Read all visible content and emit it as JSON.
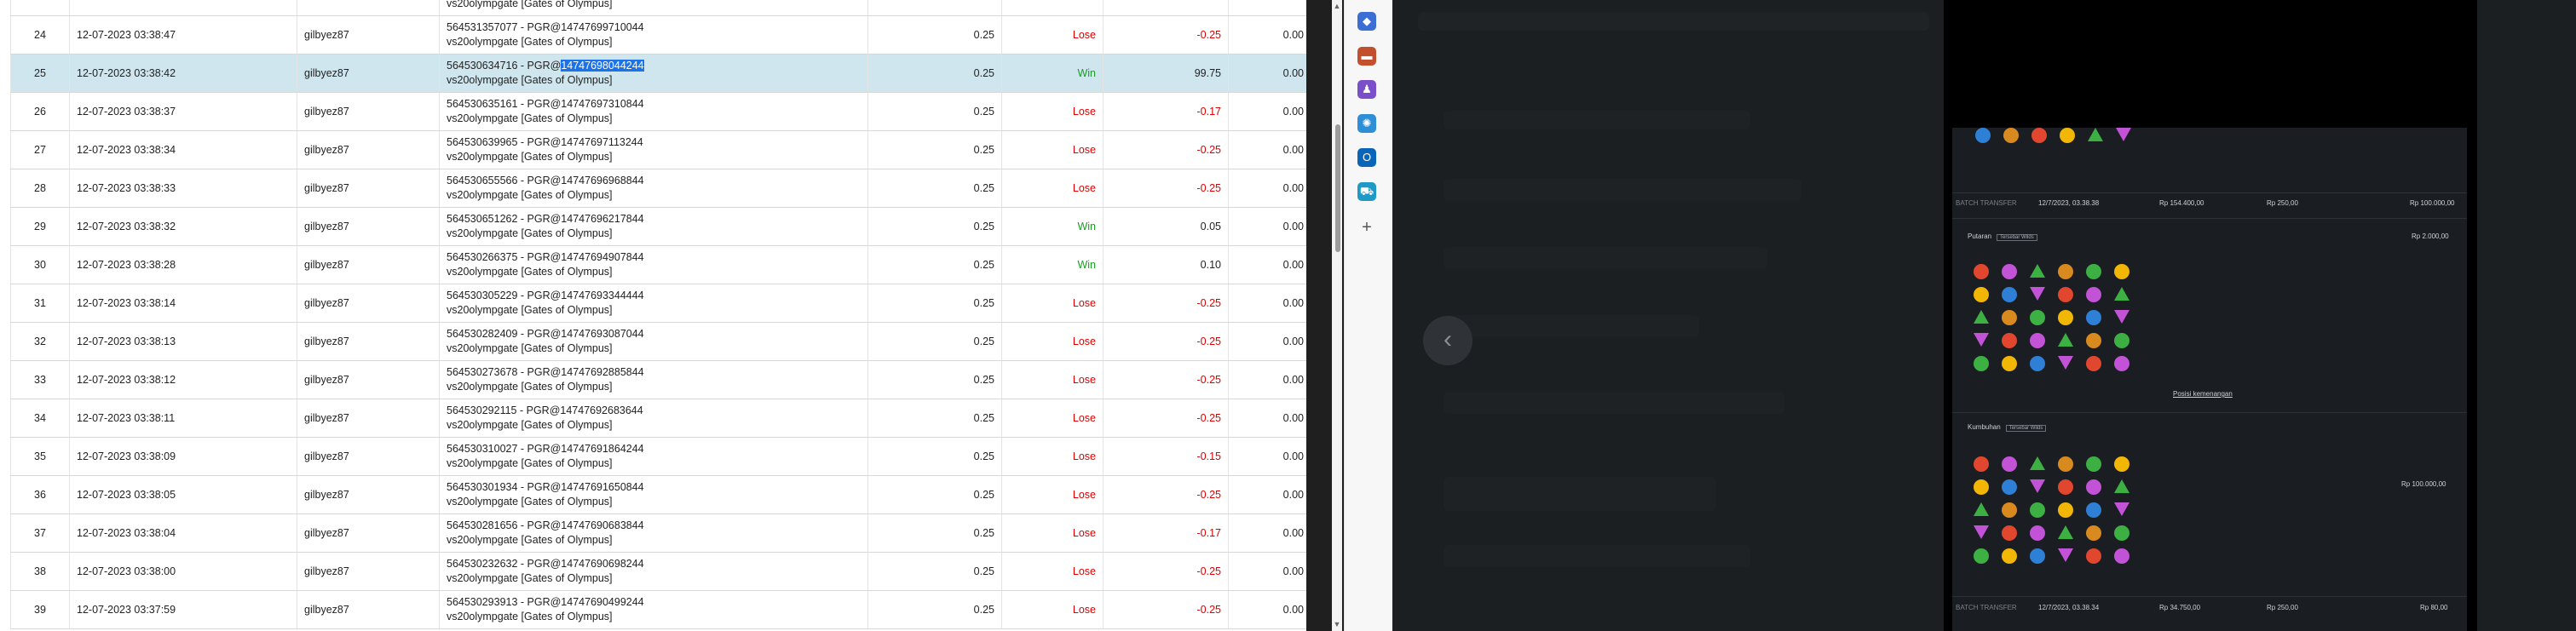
{
  "rows": [
    {
      "no": "24",
      "date": "12-07-2023 03:38:47",
      "user": "gilbyez87",
      "ref": "564531357077 - PGR@14747699710044",
      "game": "vs20olympgate [Gates of Olympus]",
      "bet": "0.25",
      "result": "Lose",
      "winloss": "-0.25",
      "jp": "0.00"
    },
    {
      "no": "25",
      "date": "12-07-2023 03:38:42",
      "user": "gilbyez87",
      "ref_prefix": "564530634716 - PGR@",
      "ref_highlight": "14747698044244",
      "game": "vs20olympgate [Gates of Olympus]",
      "bet": "0.25",
      "result": "Win",
      "winloss": "99.75",
      "jp": "0.00"
    },
    {
      "no": "26",
      "date": "12-07-2023 03:38:37",
      "user": "gilbyez87",
      "ref": "564530635161 - PGR@14747697310844",
      "game": "vs20olympgate [Gates of Olympus]",
      "bet": "0.25",
      "result": "Lose",
      "winloss": "-0.17",
      "jp": "0.00"
    },
    {
      "no": "27",
      "date": "12-07-2023 03:38:34",
      "user": "gilbyez87",
      "ref": "564530639965 - PGR@14747697113244",
      "game": "vs20olympgate [Gates of Olympus]",
      "bet": "0.25",
      "result": "Lose",
      "winloss": "-0.25",
      "jp": "0.00"
    },
    {
      "no": "28",
      "date": "12-07-2023 03:38:33",
      "user": "gilbyez87",
      "ref": "564530655566 - PGR@14747696968844",
      "game": "vs20olympgate [Gates of Olympus]",
      "bet": "0.25",
      "result": "Lose",
      "winloss": "-0.25",
      "jp": "0.00"
    },
    {
      "no": "29",
      "date": "12-07-2023 03:38:32",
      "user": "gilbyez87",
      "ref": "564530651262 - PGR@14747696217844",
      "game": "vs20olympgate [Gates of Olympus]",
      "bet": "0.25",
      "result": "Win",
      "winloss": "0.05",
      "jp": "0.00"
    },
    {
      "no": "30",
      "date": "12-07-2023 03:38:28",
      "user": "gilbyez87",
      "ref": "564530266375 - PGR@14747694907844",
      "game": "vs20olympgate [Gates of Olympus]",
      "bet": "0.25",
      "result": "Win",
      "winloss": "0.10",
      "jp": "0.00"
    },
    {
      "no": "31",
      "date": "12-07-2023 03:38:14",
      "user": "gilbyez87",
      "ref": "564530305229 - PGR@14747693344444",
      "game": "vs20olympgate [Gates of Olympus]",
      "bet": "0.25",
      "result": "Lose",
      "winloss": "-0.25",
      "jp": "0.00"
    },
    {
      "no": "32",
      "date": "12-07-2023 03:38:13",
      "user": "gilbyez87",
      "ref": "564530282409 - PGR@14747693087044",
      "game": "vs20olympgate [Gates of Olympus]",
      "bet": "0.25",
      "result": "Lose",
      "winloss": "-0.25",
      "jp": "0.00"
    },
    {
      "no": "33",
      "date": "12-07-2023 03:38:12",
      "user": "gilbyez87",
      "ref": "564530273678 - PGR@14747692885844",
      "game": "vs20olympgate [Gates of Olympus]",
      "bet": "0.25",
      "result": "Lose",
      "winloss": "-0.25",
      "jp": "0.00"
    },
    {
      "no": "34",
      "date": "12-07-2023 03:38:11",
      "user": "gilbyez87",
      "ref": "564530292115 - PGR@14747692683644",
      "game": "vs20olympgate [Gates of Olympus]",
      "bet": "0.25",
      "result": "Lose",
      "winloss": "-0.25",
      "jp": "0.00"
    },
    {
      "no": "35",
      "date": "12-07-2023 03:38:09",
      "user": "gilbyez87",
      "ref": "564530310027 - PGR@14747691864244",
      "game": "vs20olympgate [Gates of Olympus]",
      "bet": "0.25",
      "result": "Lose",
      "winloss": "-0.15",
      "jp": "0.00"
    },
    {
      "no": "36",
      "date": "12-07-2023 03:38:05",
      "user": "gilbyez87",
      "ref": "564530301934 - PGR@14747691650844",
      "game": "vs20olympgate [Gates of Olympus]",
      "bet": "0.25",
      "result": "Lose",
      "winloss": "-0.25",
      "jp": "0.00"
    },
    {
      "no": "37",
      "date": "12-07-2023 03:38:04",
      "user": "gilbyez87",
      "ref": "564530281656 - PGR@14747690683844",
      "game": "vs20olympgate [Gates of Olympus]",
      "bet": "0.25",
      "result": "Lose",
      "winloss": "-0.17",
      "jp": "0.00"
    },
    {
      "no": "38",
      "date": "12-07-2023 03:38:00",
      "user": "gilbyez87",
      "ref": "564530232632 - PGR@14747690698244",
      "game": "vs20olympgate [Gates of Olympus]",
      "bet": "0.25",
      "result": "Lose",
      "winloss": "-0.25",
      "jp": "0.00"
    },
    {
      "no": "39",
      "date": "12-07-2023 03:37:59",
      "user": "gilbyez87",
      "ref": "564530293913 - PGR@14747690499244",
      "game": "vs20olympgate [Gates of Olympus]",
      "bet": "0.25",
      "result": "Lose",
      "winloss": "-0.25",
      "jp": "0.00"
    }
  ],
  "top_partial": {
    "game": "vs20olympgate [Gates of Olympus]"
  },
  "colors": {
    "win": "#17a020",
    "lose": "#e00000",
    "selected_row": "#cfe6ee",
    "highlight": "#1a73e8"
  },
  "sidebar_icons": [
    "tag-icon",
    "briefcase-icon",
    "puzzle-icon",
    "copilot-icon",
    "outlook-icon",
    "shopping-icon",
    "add-icon"
  ],
  "viewer": {
    "prev_icon": "chevron-left-icon",
    "history_row_1": {
      "date": "12/7/2023, 03.38.38",
      "amount": "Rp 154.400,00",
      "bet": "Rp 250,00",
      "win": "Rp 100.000,00"
    },
    "section_1": {
      "title": "Putaran",
      "badge": "Tersebar Wilds",
      "amount": "Rp 2.000,00",
      "link": "Posisi kemenangan"
    },
    "section_2": {
      "title": "Kumbuhan",
      "badge": "Tersebar Wilds",
      "amount": "Rp 100.000,00"
    },
    "history_row_2": {
      "date": "12/7/2023, 03.38.34",
      "amount": "Rp 34.750,00",
      "bet": "Rp 250,00",
      "win": "Rp 80,00"
    }
  }
}
